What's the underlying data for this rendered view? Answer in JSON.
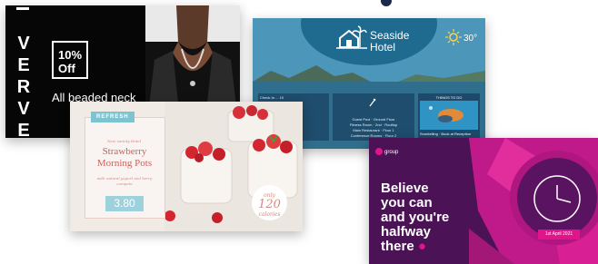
{
  "verve_card": {
    "brand": "VERVE",
    "discount_line1": "10%",
    "discount_line2": "Off",
    "promo_text": "All beaded neck"
  },
  "hotel_card": {
    "hotel_name_line1": "Seaside",
    "hotel_name_line2": "Hotel",
    "weather_icon": "sun-icon",
    "temperature": "30°",
    "info_left": "Check-In ... 10\nCheck-Out ... 11\nBreakfast ... 7-10\nWeddings ... 10",
    "info_middle": "Guest Pool · Ground Floor\nFitness Room · 2nd · Rooftop\nMain Restaurant · Floor 1\nConference Rooms · Floor 2",
    "things_title": "THINGS TO DO",
    "things_caption": "Snorkelling · Book at Reception"
  },
  "strawberry_card": {
    "ribbon": "REFRESH",
    "tagline": "New variety Hotel",
    "title_line1": "Strawberry",
    "title_line2": "Morning Pots",
    "subtitle": "with natural yogurt and berry compote",
    "price": "3.80",
    "calories_line1": "only",
    "calories_number": "120",
    "calories_line3": "calories"
  },
  "group_card": {
    "group_name": "group",
    "headline_lines": [
      "Believe",
      "you can",
      "and you're",
      "halfway",
      "there"
    ],
    "date": "1st April 2021",
    "accent_color": "#e1148a"
  }
}
